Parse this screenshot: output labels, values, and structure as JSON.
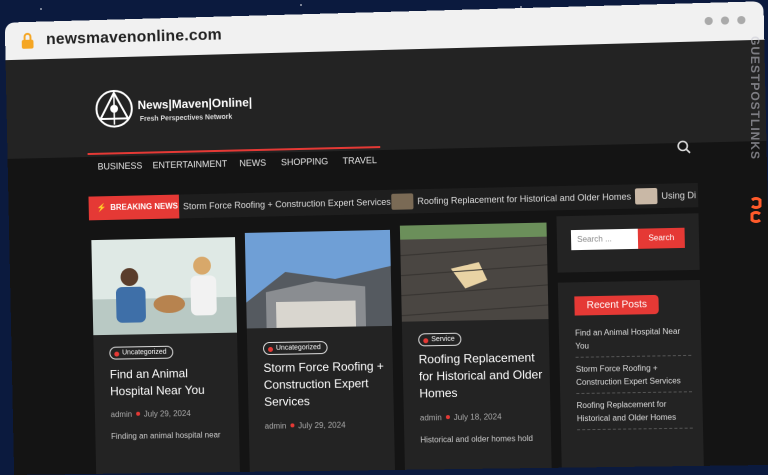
{
  "browser": {
    "url": "newsmavenonline.com"
  },
  "site": {
    "logo_name": "News|Maven|Online|",
    "tagline": "Fresh Perspectives Network"
  },
  "nav": {
    "items": [
      "BUSINESS",
      "ENTERTAINMENT",
      "NEWS",
      "SHOPPING",
      "TRAVEL"
    ]
  },
  "ticker": {
    "badge": "BREAKING NEWS",
    "items": [
      "Storm Force Roofing + Construction Expert Services",
      "Roofing Replacement for Historical and Older Homes",
      "Using Di"
    ]
  },
  "posts": [
    {
      "category": "Uncategorized",
      "title_l1": "Find an Animal",
      "title_l2": "Hospital Near You",
      "author": "admin",
      "date": "July 29, 2024",
      "excerpt": "Finding an animal hospital near"
    },
    {
      "category": "Uncategorized",
      "title_l1": "Storm Force Roofing +",
      "title_l2": "Construction Expert",
      "title_l3": "Services",
      "author": "admin",
      "date": "July 29, 2024"
    },
    {
      "category": "Service",
      "title_l1": "Roofing Replacement",
      "title_l2": "for Historical and Older",
      "title_l3": "Homes",
      "author": "admin",
      "date": "July 18, 2024",
      "excerpt": "Historical and older homes hold"
    }
  ],
  "sidebar": {
    "search_placeholder": "Search ...",
    "search_button": "Search",
    "recent_heading": "Recent Posts",
    "recent": [
      {
        "l1": "Find an Animal Hospital Near",
        "l2": "You"
      },
      {
        "l1": "Storm Force Roofing +",
        "l2": "Construction Expert Services"
      },
      {
        "l1": "Roofing Replacement for",
        "l2": "Historical and Older Homes"
      }
    ]
  },
  "watermark": "GUESTPOSTLINKS",
  "colors": {
    "accent": "#e53935",
    "page_bg": "#141414",
    "card_bg": "#232323",
    "backdrop": "#0b1a3e"
  }
}
